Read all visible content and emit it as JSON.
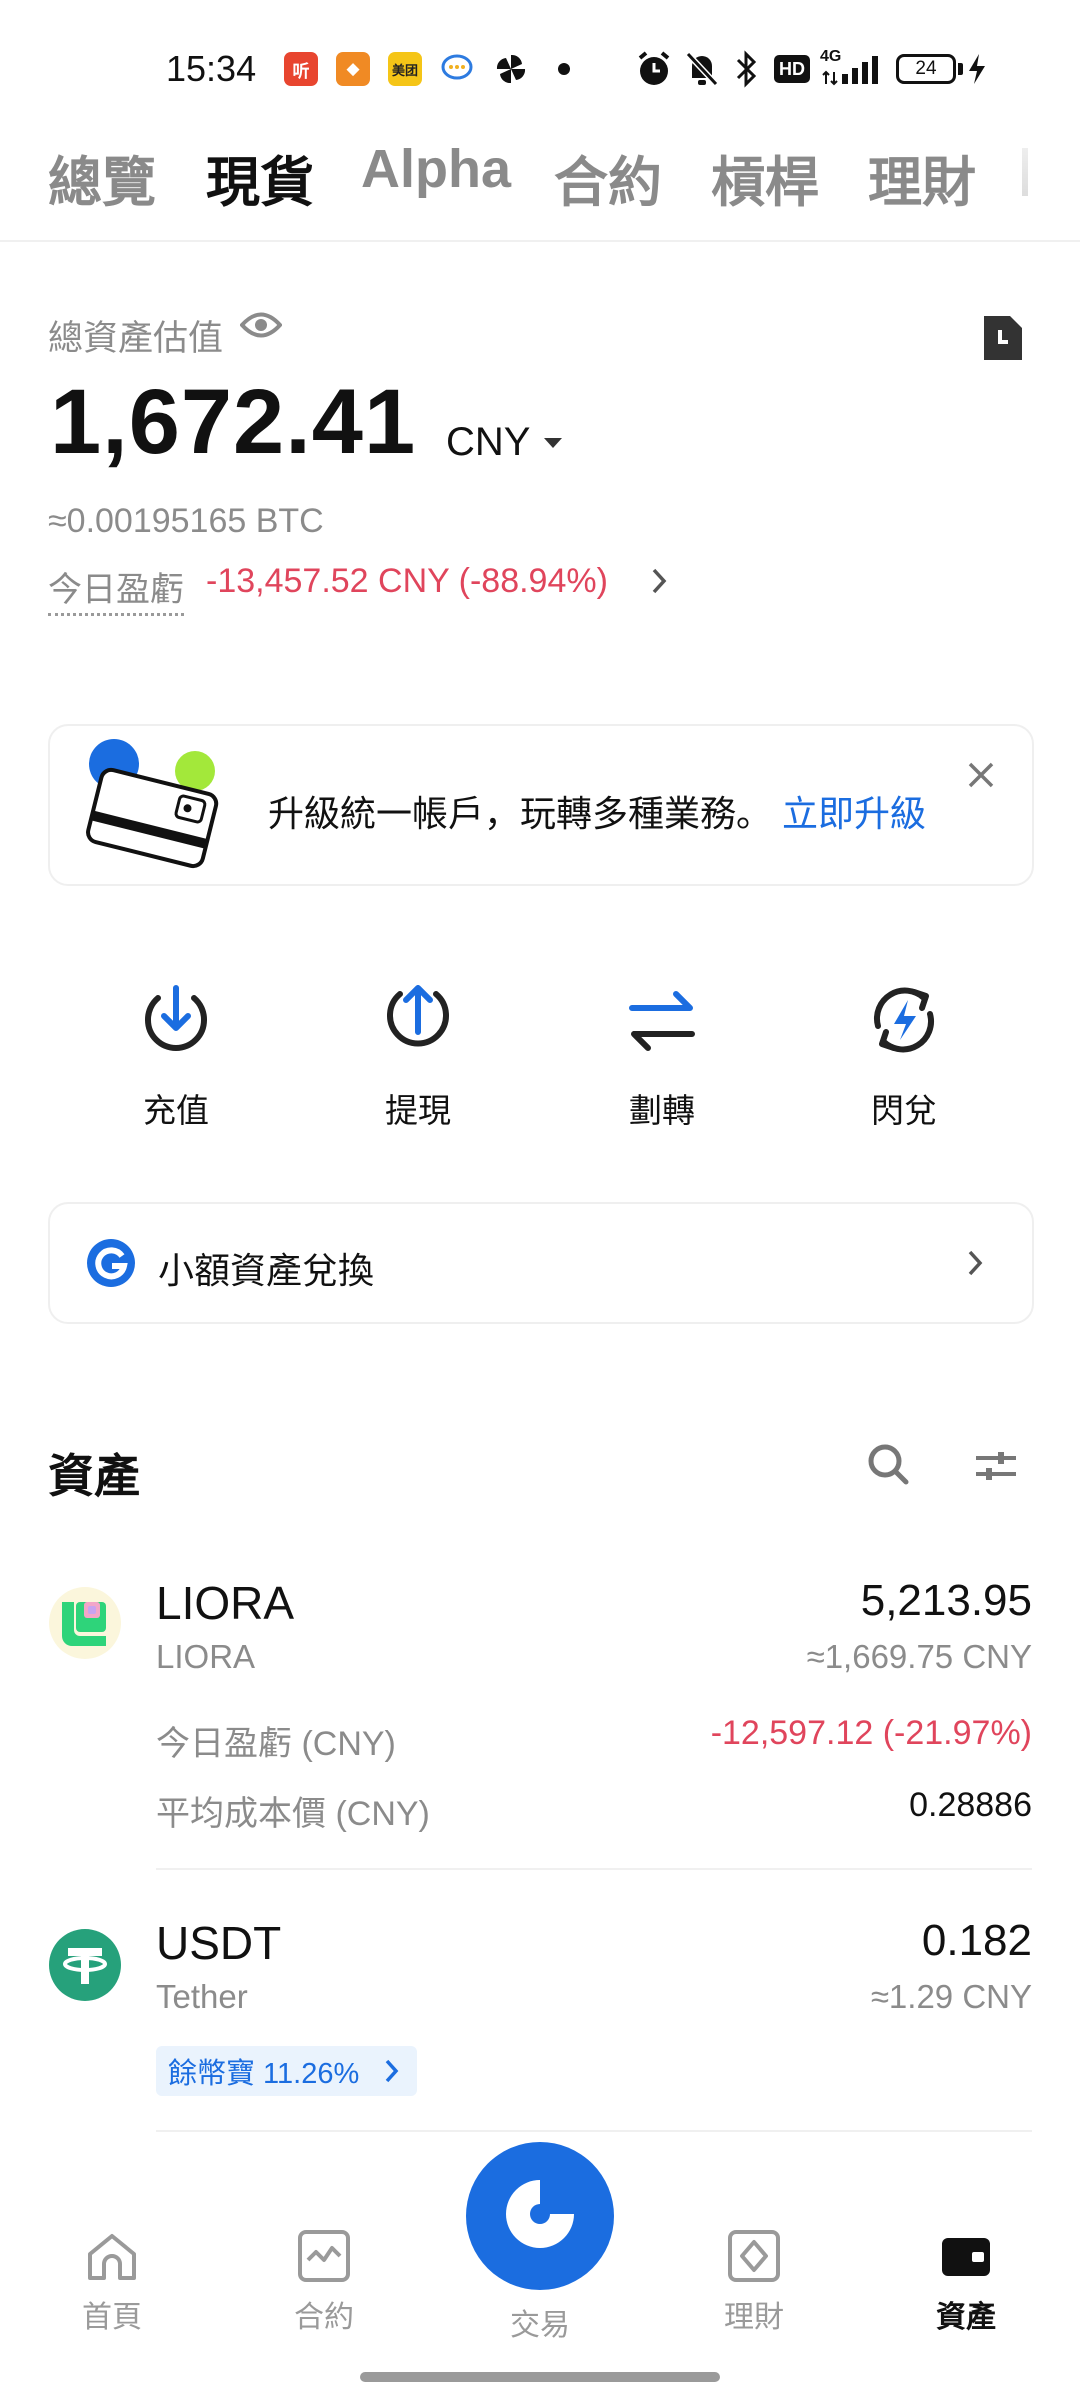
{
  "status_bar": {
    "time": "15:34",
    "app_icons": [
      {
        "name": "ting-app-icon",
        "label": "听",
        "color": "#e8452f"
      },
      {
        "name": "orange-app-icon",
        "label": "◆",
        "color": "#f08a24"
      },
      {
        "name": "meituan-app-icon",
        "label": "美团",
        "color": "#f5c517"
      },
      {
        "name": "chat-app-icon",
        "label": "",
        "color": "#ffffff"
      },
      {
        "name": "pinwheel-app-icon",
        "label": "",
        "color": "#ffffff"
      }
    ],
    "network": "4G",
    "battery": "24"
  },
  "tabs": [
    "總覽",
    "現貨",
    "Alpha",
    "合約",
    "槓桿",
    "理財"
  ],
  "active_tab": "現貨",
  "balance": {
    "label": "總資產估值",
    "amount": "1,672.41",
    "currency": "CNY",
    "btc": "≈0.00195165 BTC",
    "pnl_label": "今日盈虧",
    "pnl_value": "-13,457.52 CNY (-88.94%)"
  },
  "banner": {
    "text": "升級統一帳戶，玩轉多種業務。",
    "link": "立即升級"
  },
  "actions": [
    {
      "name": "deposit",
      "label": "充值",
      "icon": "download-icon"
    },
    {
      "name": "withdraw",
      "label": "提現",
      "icon": "upload-icon"
    },
    {
      "name": "transfer",
      "label": "劃轉",
      "icon": "swap-arrows-icon"
    },
    {
      "name": "flash-exchange",
      "label": "閃兌",
      "icon": "flash-refresh-icon"
    }
  ],
  "small_convert": {
    "label": "小額資產兌換"
  },
  "assets_section": {
    "title": "資產"
  },
  "assets": [
    {
      "symbol": "LIORA",
      "name": "LIORA",
      "amount": "5,213.95",
      "cny": "≈1,669.75 CNY",
      "pnl_label": "今日盈虧 (CNY)",
      "pnl_value": "-12,597.12 (-21.97%)",
      "cost_label": "平均成本價 (CNY)",
      "cost_value": "0.28886"
    },
    {
      "symbol": "USDT",
      "name": "Tether",
      "amount": "0.182",
      "cny": "≈1.29 CNY",
      "earn_tag": "餘幣寶 11.26%"
    }
  ],
  "bottom_nav": [
    {
      "name": "home",
      "label": "首頁",
      "icon": "home-icon"
    },
    {
      "name": "futures",
      "label": "合約",
      "icon": "chart-icon"
    },
    {
      "name": "trade",
      "label": "交易",
      "icon": "trade-logo-icon"
    },
    {
      "name": "earn",
      "label": "理財",
      "icon": "earn-icon"
    },
    {
      "name": "assets",
      "label": "資產",
      "icon": "wallet-icon"
    }
  ],
  "colors": {
    "accent": "#1b6de0",
    "negative": "#e0455c",
    "liora": "#2ed47a",
    "tether": "#26a17b"
  }
}
